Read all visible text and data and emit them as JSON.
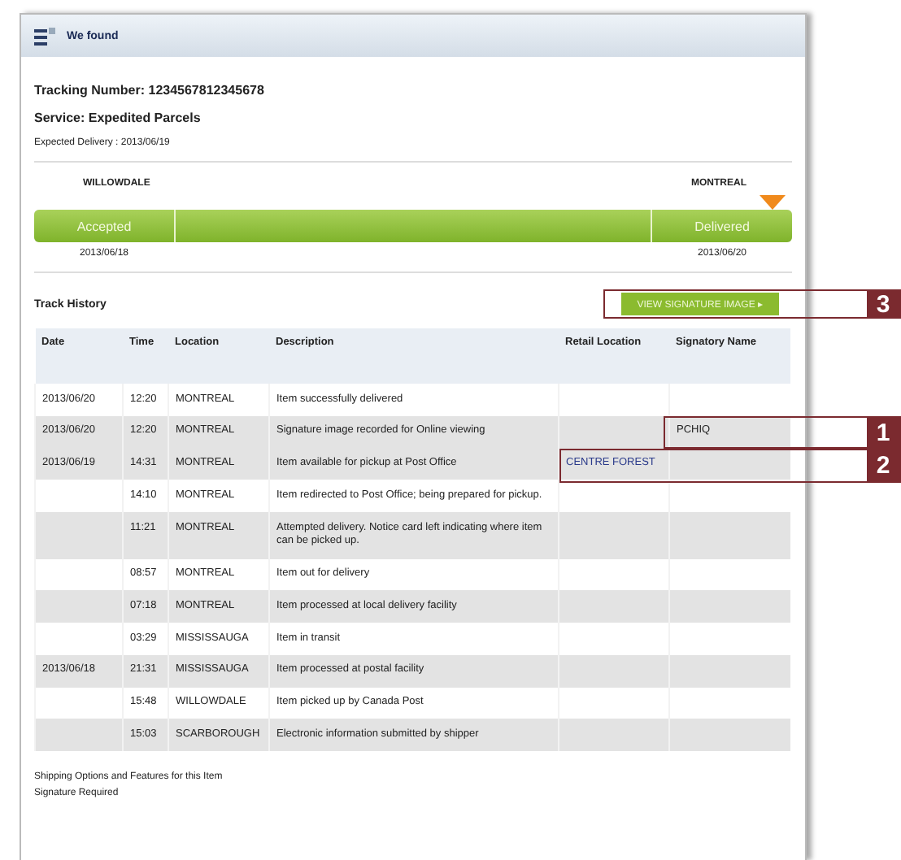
{
  "window": {
    "title": "We found"
  },
  "summary": {
    "tracking": "Tracking Number: 1234567812345678",
    "service": "Service: Expedited Parcels",
    "expected": "Expected Delivery : 2013/06/19"
  },
  "progress": {
    "origin": "WILLOWDALE",
    "destination": "MONTREAL",
    "level": 1,
    "stages": [
      {
        "label": "Accepted",
        "date": "2013/06/18",
        "current": false
      },
      {
        "label": "Delivered",
        "date": "2013/06/20",
        "current": true
      }
    ]
  },
  "history": {
    "title": "Track History",
    "button": "VIEW SIGNATURE IMAGE ▸",
    "columns": [
      "Date",
      "Time",
      "Location",
      "Description",
      "Retail Location",
      "Signatory Name"
    ],
    "rows": [
      {
        "date": "2013/06/20",
        "time": "12:20",
        "location": "MONTREAL",
        "description": "Item successfully delivered",
        "shaded": false
      },
      {
        "date": "2013/06/20",
        "time": "12:20",
        "location": "MONTREAL",
        "description": "Signature image recorded for Online viewing",
        "signatory": "PCHIQ",
        "shaded": true
      },
      {
        "date": "2013/06/19",
        "time": "14:31",
        "location": "MONTREAL",
        "description": "Item available for pickup at Post Office",
        "retail": "CENTRE FOREST",
        "shaded": true
      },
      {
        "time": "14:10",
        "location": "MONTREAL",
        "description": "Item redirected to Post Office; being prepared for pickup.",
        "shaded": false
      },
      {
        "time": "11:21",
        "location": "MONTREAL",
        "description": "Attempted delivery. Notice card left indicating where item can be picked up.",
        "shaded": true
      },
      {
        "time": "08:57",
        "location": "MONTREAL",
        "description": "Item out for delivery",
        "shaded": false
      },
      {
        "time": "07:18",
        "location": "MONTREAL",
        "description": "Item processed at local delivery facility",
        "shaded": true
      },
      {
        "time": "03:29",
        "location": "MISSISSAUGA",
        "description": "Item in transit",
        "shaded": false
      },
      {
        "date": "2013/06/18",
        "time": "21:31",
        "location": "MISSISSAUGA",
        "description": "Item processed at postal facility",
        "shaded": true
      },
      {
        "time": "15:48",
        "location": "WILLOWDALE",
        "description": "Item picked up by Canada Post",
        "shaded": false
      },
      {
        "time": "15:03",
        "location": "SCARBOROUGH",
        "description": "Electronic information submitted by shipper",
        "shaded": true
      }
    ]
  },
  "footer": {
    "title": "Shipping Options and Features for this Item",
    "option": "Signature Required"
  },
  "callouts": [
    {
      "number": "3"
    },
    {
      "number": "1"
    },
    {
      "number": "2"
    }
  ]
}
